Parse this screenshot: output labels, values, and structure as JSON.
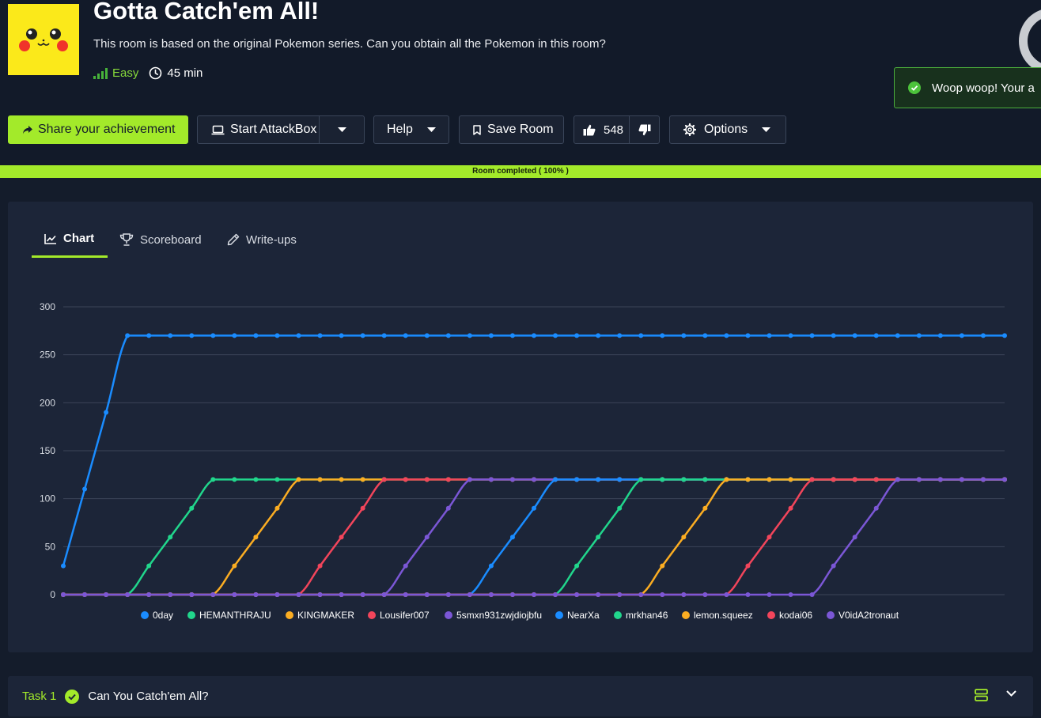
{
  "room": {
    "title": "Gotta Catch'em All!",
    "description": "This room is based on the original Pokemon series. Can you obtain all the Pokemon in this room?",
    "difficulty": "Easy",
    "duration": "45 min"
  },
  "toast": {
    "message": "Woop woop! Your a"
  },
  "toolbar": {
    "share_label": "Share your achievement",
    "attackbox_label": "Start AttackBox",
    "help_label": "Help",
    "save_label": "Save Room",
    "likes": "548",
    "options_label": "Options"
  },
  "progress": {
    "label": "Room completed ( 100% )",
    "percent": 100
  },
  "tabs": [
    {
      "label": "Chart",
      "active": true
    },
    {
      "label": "Scoreboard",
      "active": false
    },
    {
      "label": "Write-ups",
      "active": false
    }
  ],
  "chart_data": {
    "type": "line",
    "ylim": [
      0,
      300
    ],
    "yticks": [
      "0",
      "50",
      "100",
      "150",
      "200",
      "250",
      "300"
    ],
    "grid": true,
    "legend_position": "bottom",
    "series": [
      {
        "name": "0day",
        "color": "#1a8cff",
        "values": [
          30,
          110,
          190,
          270,
          270,
          270,
          270,
          270,
          270,
          270,
          270,
          270,
          270,
          270,
          270,
          270,
          270,
          270,
          270,
          270,
          270,
          270,
          270,
          270,
          270,
          270,
          270,
          270,
          270,
          270,
          270,
          270,
          270,
          270,
          270,
          270,
          270,
          270,
          270,
          270,
          270,
          270,
          270,
          270,
          270
        ]
      },
      {
        "name": "HEMANTHRAJU",
        "color": "#21d68c",
        "values": [
          0,
          0,
          0,
          0,
          30,
          60,
          90,
          120,
          120,
          120,
          120,
          120,
          120,
          120,
          120,
          120,
          120,
          120,
          120,
          120,
          120,
          120,
          120,
          120,
          120,
          120,
          120,
          120,
          120,
          120,
          120,
          120,
          120,
          120,
          120,
          120,
          120,
          120,
          120,
          120,
          120,
          120,
          120,
          120,
          120
        ]
      },
      {
        "name": "KINGMAKER",
        "color": "#fbad22",
        "values": [
          0,
          0,
          0,
          0,
          0,
          0,
          0,
          0,
          30,
          60,
          90,
          120,
          120,
          120,
          120,
          120,
          120,
          120,
          120,
          120,
          120,
          120,
          120,
          120,
          120,
          120,
          120,
          120,
          120,
          120,
          120,
          120,
          120,
          120,
          120,
          120,
          120,
          120,
          120,
          120,
          120,
          120,
          120,
          120,
          120
        ]
      },
      {
        "name": "Lousifer007",
        "color": "#f2455b",
        "values": [
          0,
          0,
          0,
          0,
          0,
          0,
          0,
          0,
          0,
          0,
          0,
          0,
          30,
          60,
          90,
          120,
          120,
          120,
          120,
          120,
          120,
          120,
          120,
          120,
          120,
          120,
          120,
          120,
          120,
          120,
          120,
          120,
          120,
          120,
          120,
          120,
          120,
          120,
          120,
          120,
          120,
          120,
          120,
          120,
          120
        ]
      },
      {
        "name": "5smxn931zwjdiojbfu",
        "color": "#7b57d6",
        "values": [
          0,
          0,
          0,
          0,
          0,
          0,
          0,
          0,
          0,
          0,
          0,
          0,
          0,
          0,
          0,
          0,
          30,
          60,
          90,
          120,
          120,
          120,
          120,
          120,
          120,
          120,
          120,
          120,
          120,
          120,
          120,
          120,
          120,
          120,
          120,
          120,
          120,
          120,
          120,
          120,
          120,
          120,
          120,
          120,
          120
        ]
      },
      {
        "name": "NearXa",
        "color": "#1a8cff",
        "values": [
          0,
          0,
          0,
          0,
          0,
          0,
          0,
          0,
          0,
          0,
          0,
          0,
          0,
          0,
          0,
          0,
          0,
          0,
          0,
          0,
          30,
          60,
          90,
          120,
          120,
          120,
          120,
          120,
          120,
          120,
          120,
          120,
          120,
          120,
          120,
          120,
          120,
          120,
          120,
          120,
          120,
          120,
          120,
          120,
          120
        ]
      },
      {
        "name": "mrkhan46",
        "color": "#21d68c",
        "values": [
          0,
          0,
          0,
          0,
          0,
          0,
          0,
          0,
          0,
          0,
          0,
          0,
          0,
          0,
          0,
          0,
          0,
          0,
          0,
          0,
          0,
          0,
          0,
          0,
          30,
          60,
          90,
          120,
          120,
          120,
          120,
          120,
          120,
          120,
          120,
          120,
          120,
          120,
          120,
          120,
          120,
          120,
          120,
          120,
          120
        ]
      },
      {
        "name": "lemon.squeez",
        "color": "#fbad22",
        "values": [
          0,
          0,
          0,
          0,
          0,
          0,
          0,
          0,
          0,
          0,
          0,
          0,
          0,
          0,
          0,
          0,
          0,
          0,
          0,
          0,
          0,
          0,
          0,
          0,
          0,
          0,
          0,
          0,
          30,
          60,
          90,
          120,
          120,
          120,
          120,
          120,
          120,
          120,
          120,
          120,
          120,
          120,
          120,
          120,
          120
        ]
      },
      {
        "name": "kodai06",
        "color": "#f2455b",
        "values": [
          0,
          0,
          0,
          0,
          0,
          0,
          0,
          0,
          0,
          0,
          0,
          0,
          0,
          0,
          0,
          0,
          0,
          0,
          0,
          0,
          0,
          0,
          0,
          0,
          0,
          0,
          0,
          0,
          0,
          0,
          0,
          0,
          30,
          60,
          90,
          120,
          120,
          120,
          120,
          120,
          120,
          120,
          120,
          120,
          120
        ]
      },
      {
        "name": "V0idA2tronaut",
        "color": "#7b57d6",
        "values": [
          0,
          0,
          0,
          0,
          0,
          0,
          0,
          0,
          0,
          0,
          0,
          0,
          0,
          0,
          0,
          0,
          0,
          0,
          0,
          0,
          0,
          0,
          0,
          0,
          0,
          0,
          0,
          0,
          0,
          0,
          0,
          0,
          0,
          0,
          0,
          0,
          30,
          60,
          90,
          120,
          120,
          120,
          120,
          120,
          120
        ]
      }
    ]
  },
  "tasks": [
    {
      "number": "Task 1",
      "title": "Can You Catch'em All?",
      "completed": true
    }
  ],
  "colors": {
    "accent": "#a3ea2a",
    "background": "#141c2b",
    "panel": "#1c2538",
    "header": "#121a29"
  }
}
